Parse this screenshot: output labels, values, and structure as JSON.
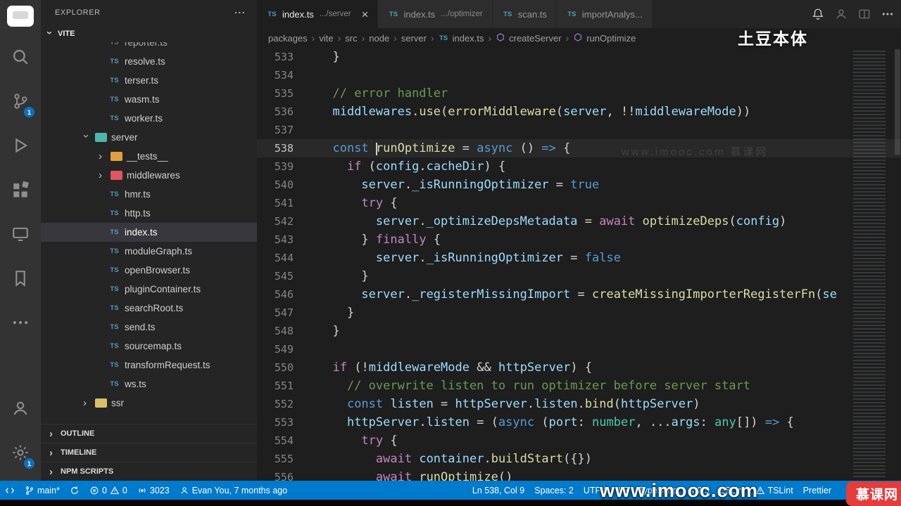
{
  "colors": {
    "accent": "#007acc",
    "activity_badge": "#0e70c0",
    "ts_icon": "#519aba",
    "selection_bg": "#37373d"
  },
  "activity_bar": {
    "items": [
      {
        "name": "search",
        "badge": null
      },
      {
        "name": "source-control",
        "badge": "1"
      },
      {
        "name": "run-debug",
        "badge": null
      },
      {
        "name": "extensions",
        "badge": null
      },
      {
        "name": "remote-explorer",
        "badge": null
      },
      {
        "name": "bookmarks",
        "badge": null
      },
      {
        "name": "more-views",
        "badge": null
      }
    ],
    "bottom_items": [
      {
        "name": "account",
        "badge": null
      },
      {
        "name": "settings",
        "badge": "1"
      }
    ]
  },
  "sidebar": {
    "header": "EXPLORER",
    "more_label": "⋯",
    "section": "VITE",
    "tree": [
      {
        "label": "reporter.ts",
        "kind": "ts",
        "level": 3,
        "clipped": true
      },
      {
        "label": "resolve.ts",
        "kind": "ts",
        "level": 3
      },
      {
        "label": "terser.ts",
        "kind": "ts",
        "level": 3
      },
      {
        "label": "wasm.ts",
        "kind": "ts",
        "level": 3
      },
      {
        "label": "worker.ts",
        "kind": "ts",
        "level": 3
      },
      {
        "label": "server",
        "kind": "folder",
        "level": 2,
        "expanded": true,
        "color": "#4db6ac"
      },
      {
        "label": "__tests__",
        "kind": "folder",
        "level": 3,
        "expanded": false,
        "color": "#e2a03f"
      },
      {
        "label": "middlewares",
        "kind": "folder",
        "level": 3,
        "expanded": false,
        "color": "#e05561"
      },
      {
        "label": "hmr.ts",
        "kind": "ts",
        "level": 3
      },
      {
        "label": "http.ts",
        "kind": "ts",
        "level": 3
      },
      {
        "label": "index.ts",
        "kind": "ts",
        "level": 3,
        "selected": true
      },
      {
        "label": "moduleGraph.ts",
        "kind": "ts",
        "level": 3
      },
      {
        "label": "openBrowser.ts",
        "kind": "ts",
        "level": 3
      },
      {
        "label": "pluginContainer.ts",
        "kind": "ts",
        "level": 3
      },
      {
        "label": "searchRoot.ts",
        "kind": "ts",
        "level": 3
      },
      {
        "label": "send.ts",
        "kind": "ts",
        "level": 3
      },
      {
        "label": "sourcemap.ts",
        "kind": "ts",
        "level": 3
      },
      {
        "label": "transformRequest.ts",
        "kind": "ts",
        "level": 3
      },
      {
        "label": "ws.ts",
        "kind": "ts",
        "level": 3
      },
      {
        "label": "ssr",
        "kind": "folder",
        "level": 2,
        "expanded": false,
        "color": "#d8c06a"
      }
    ],
    "bottom_sections": [
      "OUTLINE",
      "TIMELINE",
      "NPM SCRIPTS"
    ]
  },
  "tabs": {
    "items": [
      {
        "title": "index.ts",
        "hint": ".../server",
        "active": true,
        "close": "×"
      },
      {
        "title": "index.ts",
        "hint": ".../optimizer",
        "active": false
      },
      {
        "title": "scan.ts",
        "hint": "",
        "active": false
      },
      {
        "title": "importAnalys...",
        "hint": "",
        "active": false
      }
    ],
    "actions": [
      {
        "name": "notifications",
        "icon": "bell",
        "dim": false
      },
      {
        "name": "account",
        "icon": "account",
        "dim": true
      },
      {
        "name": "split-editor",
        "icon": "columns",
        "dim": true
      },
      {
        "name": "more-actions",
        "icon": "more",
        "dim": false
      }
    ]
  },
  "breadcrumbs": {
    "items": [
      {
        "label": "packages",
        "icon": null
      },
      {
        "label": "vite",
        "icon": null
      },
      {
        "label": "src",
        "icon": null
      },
      {
        "label": "node",
        "icon": null
      },
      {
        "label": "server",
        "icon": null
      },
      {
        "label": "index.ts",
        "icon": "ts"
      },
      {
        "label": "createServer",
        "icon": "method"
      },
      {
        "label": "runOptimize",
        "icon": "method"
      }
    ]
  },
  "editor": {
    "syntax": {
      "kw": "#569cd6",
      "ctrl": "#c586c0",
      "fn": "#dcdcaa",
      "var": "#9cdcfe",
      "type": "#4ec9b0",
      "cmt": "#6a9955",
      "punc": "#d4d4d4",
      "op": "#d4d4d4"
    },
    "cursor": {
      "line": 538,
      "col": 9
    },
    "lines": [
      {
        "num": 533,
        "indent": 2,
        "tokens": [
          {
            "t": "}",
            "c": "punc"
          }
        ]
      },
      {
        "num": 534,
        "indent": 0,
        "tokens": []
      },
      {
        "num": 535,
        "indent": 2,
        "tokens": [
          {
            "t": "// error handler",
            "c": "cmt"
          }
        ]
      },
      {
        "num": 536,
        "indent": 2,
        "tokens": [
          {
            "t": "middlewares",
            "c": "var"
          },
          {
            "t": ".",
            "c": "punc"
          },
          {
            "t": "use",
            "c": "fn"
          },
          {
            "t": "(",
            "c": "punc"
          },
          {
            "t": "errorMiddleware",
            "c": "fn"
          },
          {
            "t": "(",
            "c": "punc"
          },
          {
            "t": "server",
            "c": "var"
          },
          {
            "t": ", ",
            "c": "punc"
          },
          {
            "t": "!!",
            "c": "op"
          },
          {
            "t": "middlewareMode",
            "c": "var"
          },
          {
            "t": "))",
            "c": "punc"
          }
        ]
      },
      {
        "num": 537,
        "indent": 0,
        "tokens": []
      },
      {
        "num": 538,
        "indent": 2,
        "active": true,
        "tokens": [
          {
            "t": "const",
            "c": "kw"
          },
          {
            "t": " ",
            "c": "punc"
          },
          {
            "t": "runOptimize",
            "c": "fn"
          },
          {
            "t": " = ",
            "c": "punc"
          },
          {
            "t": "async",
            "c": "kw"
          },
          {
            "t": " () ",
            "c": "punc"
          },
          {
            "t": "=>",
            "c": "kw"
          },
          {
            "t": " {",
            "c": "punc"
          }
        ]
      },
      {
        "num": 539,
        "indent": 4,
        "tokens": [
          {
            "t": "if",
            "c": "ctrl"
          },
          {
            "t": " (",
            "c": "punc"
          },
          {
            "t": "config",
            "c": "var"
          },
          {
            "t": ".",
            "c": "punc"
          },
          {
            "t": "cacheDir",
            "c": "var"
          },
          {
            "t": ") {",
            "c": "punc"
          }
        ]
      },
      {
        "num": 540,
        "indent": 6,
        "tokens": [
          {
            "t": "server",
            "c": "var"
          },
          {
            "t": ".",
            "c": "punc"
          },
          {
            "t": "_isRunningOptimizer",
            "c": "var"
          },
          {
            "t": " = ",
            "c": "punc"
          },
          {
            "t": "true",
            "c": "kw"
          }
        ]
      },
      {
        "num": 541,
        "indent": 6,
        "tokens": [
          {
            "t": "try",
            "c": "ctrl"
          },
          {
            "t": " {",
            "c": "punc"
          }
        ]
      },
      {
        "num": 542,
        "indent": 8,
        "tokens": [
          {
            "t": "server",
            "c": "var"
          },
          {
            "t": ".",
            "c": "punc"
          },
          {
            "t": "_optimizeDepsMetadata",
            "c": "var"
          },
          {
            "t": " = ",
            "c": "punc"
          },
          {
            "t": "await",
            "c": "ctrl"
          },
          {
            "t": " ",
            "c": "punc"
          },
          {
            "t": "optimizeDeps",
            "c": "fn"
          },
          {
            "t": "(",
            "c": "punc"
          },
          {
            "t": "config",
            "c": "var"
          },
          {
            "t": ")",
            "c": "punc"
          }
        ]
      },
      {
        "num": 543,
        "indent": 6,
        "tokens": [
          {
            "t": "} ",
            "c": "punc"
          },
          {
            "t": "finally",
            "c": "ctrl"
          },
          {
            "t": " {",
            "c": "punc"
          }
        ]
      },
      {
        "num": 544,
        "indent": 8,
        "tokens": [
          {
            "t": "server",
            "c": "var"
          },
          {
            "t": ".",
            "c": "punc"
          },
          {
            "t": "_isRunningOptimizer",
            "c": "var"
          },
          {
            "t": " = ",
            "c": "punc"
          },
          {
            "t": "false",
            "c": "kw"
          }
        ]
      },
      {
        "num": 545,
        "indent": 6,
        "tokens": [
          {
            "t": "}",
            "c": "punc"
          }
        ]
      },
      {
        "num": 546,
        "indent": 6,
        "tokens": [
          {
            "t": "server",
            "c": "var"
          },
          {
            "t": ".",
            "c": "punc"
          },
          {
            "t": "_registerMissingImport",
            "c": "var"
          },
          {
            "t": " = ",
            "c": "punc"
          },
          {
            "t": "createMissingImporterRegisterFn",
            "c": "fn"
          },
          {
            "t": "(",
            "c": "punc"
          },
          {
            "t": "se",
            "c": "var"
          }
        ]
      },
      {
        "num": 547,
        "indent": 4,
        "tokens": [
          {
            "t": "}",
            "c": "punc"
          }
        ]
      },
      {
        "num": 548,
        "indent": 2,
        "tokens": [
          {
            "t": "}",
            "c": "punc"
          }
        ]
      },
      {
        "num": 549,
        "indent": 0,
        "tokens": []
      },
      {
        "num": 550,
        "indent": 2,
        "tokens": [
          {
            "t": "if",
            "c": "ctrl"
          },
          {
            "t": " (",
            "c": "punc"
          },
          {
            "t": "!",
            "c": "op"
          },
          {
            "t": "middlewareMode",
            "c": "var"
          },
          {
            "t": " ",
            "c": "punc"
          },
          {
            "t": "&&",
            "c": "op"
          },
          {
            "t": " ",
            "c": "punc"
          },
          {
            "t": "httpServer",
            "c": "var"
          },
          {
            "t": ") {",
            "c": "punc"
          }
        ]
      },
      {
        "num": 551,
        "indent": 4,
        "tokens": [
          {
            "t": "// overwrite listen to run optimizer before server start",
            "c": "cmt"
          }
        ]
      },
      {
        "num": 552,
        "indent": 4,
        "tokens": [
          {
            "t": "const",
            "c": "kw"
          },
          {
            "t": " ",
            "c": "punc"
          },
          {
            "t": "listen",
            "c": "var"
          },
          {
            "t": " = ",
            "c": "punc"
          },
          {
            "t": "httpServer",
            "c": "var"
          },
          {
            "t": ".",
            "c": "punc"
          },
          {
            "t": "listen",
            "c": "var"
          },
          {
            "t": ".",
            "c": "punc"
          },
          {
            "t": "bind",
            "c": "fn"
          },
          {
            "t": "(",
            "c": "punc"
          },
          {
            "t": "httpServer",
            "c": "var"
          },
          {
            "t": ")",
            "c": "punc"
          }
        ]
      },
      {
        "num": 553,
        "indent": 4,
        "tokens": [
          {
            "t": "httpServer",
            "c": "var"
          },
          {
            "t": ".",
            "c": "punc"
          },
          {
            "t": "listen",
            "c": "var"
          },
          {
            "t": " = (",
            "c": "punc"
          },
          {
            "t": "async",
            "c": "kw"
          },
          {
            "t": " (",
            "c": "punc"
          },
          {
            "t": "port",
            "c": "var"
          },
          {
            "t": ": ",
            "c": "punc"
          },
          {
            "t": "number",
            "c": "type"
          },
          {
            "t": ", ",
            "c": "punc"
          },
          {
            "t": "...",
            "c": "op"
          },
          {
            "t": "args",
            "c": "var"
          },
          {
            "t": ": ",
            "c": "punc"
          },
          {
            "t": "any",
            "c": "type"
          },
          {
            "t": "[]) ",
            "c": "punc"
          },
          {
            "t": "=>",
            "c": "kw"
          },
          {
            "t": " {",
            "c": "punc"
          }
        ]
      },
      {
        "num": 554,
        "indent": 6,
        "tokens": [
          {
            "t": "try",
            "c": "ctrl"
          },
          {
            "t": " {",
            "c": "punc"
          }
        ]
      },
      {
        "num": 555,
        "indent": 8,
        "tokens": [
          {
            "t": "await",
            "c": "ctrl"
          },
          {
            "t": " ",
            "c": "punc"
          },
          {
            "t": "container",
            "c": "var"
          },
          {
            "t": ".",
            "c": "punc"
          },
          {
            "t": "buildStart",
            "c": "fn"
          },
          {
            "t": "({})",
            "c": "punc"
          }
        ]
      },
      {
        "num": 556,
        "indent": 8,
        "tokens": [
          {
            "t": "await",
            "c": "ctrl"
          },
          {
            "t": " ",
            "c": "punc"
          },
          {
            "t": "runOptimize",
            "c": "fn"
          },
          {
            "t": "()",
            "c": "punc"
          }
        ]
      }
    ]
  },
  "status_bar": {
    "left": [
      {
        "name": "remote",
        "parts": [
          {
            "icon": "remote"
          }
        ]
      },
      {
        "name": "git-branch",
        "parts": [
          {
            "icon": "branch"
          },
          {
            "text": "main*"
          }
        ]
      },
      {
        "name": "sync",
        "parts": [
          {
            "icon": "sync"
          }
        ]
      },
      {
        "name": "problems",
        "parts": [
          {
            "icon": "error"
          },
          {
            "text": "0"
          },
          {
            "icon": "warning"
          },
          {
            "text": "0"
          }
        ]
      },
      {
        "name": "port",
        "parts": [
          {
            "icon": "broadcast"
          },
          {
            "text": "3023"
          }
        ]
      },
      {
        "name": "git-blame",
        "parts": [
          {
            "icon": "person"
          },
          {
            "text": "Evan You, 7 months ago"
          }
        ]
      }
    ],
    "right": [
      {
        "name": "cursor-position",
        "parts": [
          {
            "text": "Ln 538, Col 9"
          }
        ]
      },
      {
        "name": "indentation",
        "parts": [
          {
            "text": "Spaces: 2"
          }
        ]
      },
      {
        "name": "encoding",
        "parts": [
          {
            "text": "UTF-8"
          }
        ]
      },
      {
        "name": "eol",
        "parts": [
          {
            "text": "LF"
          }
        ]
      },
      {
        "name": "language",
        "parts": [
          {
            "text": "TypeScript"
          }
        ]
      },
      {
        "name": "ts-version",
        "parts": [
          {
            "text": "4.2.5"
          }
        ]
      },
      {
        "name": "eslint",
        "parts": [
          {
            "text": "ESLint"
          }
        ]
      },
      {
        "name": "tslint",
        "parts": [
          {
            "icon": "warning"
          },
          {
            "text": "TSLint"
          }
        ]
      },
      {
        "name": "prettier",
        "parts": [
          {
            "text": "Prettier"
          }
        ]
      }
    ]
  },
  "watermarks": {
    "top_right": "土豆本体",
    "bottom_banner": "www.imooc.com",
    "corner_logo": "慕课网",
    "editor_ghost": "www.imooc.com 慕课网"
  }
}
